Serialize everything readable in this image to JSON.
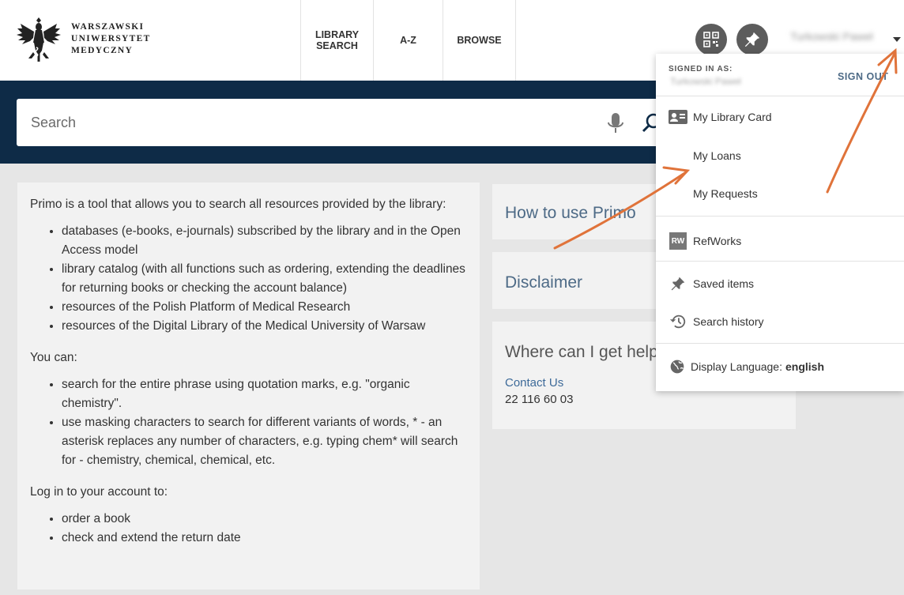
{
  "header": {
    "logo_lines": [
      "WARSZAWSKI",
      "UNIWERSYTET",
      "MEDYCZNY"
    ],
    "nav": [
      {
        "label": "LIBRARY\nSEARCH"
      },
      {
        "label": "A-Z"
      },
      {
        "label": "BROWSE"
      }
    ],
    "user_name": "Turkowski Paweł",
    "icons": {
      "qr": "qr-code-icon",
      "pin": "pin-icon",
      "caret": "chevron-down-icon"
    }
  },
  "search": {
    "placeholder": "Search",
    "icons": {
      "mic": "microphone-icon",
      "search": "search-icon"
    }
  },
  "main": {
    "intro": "Primo is a tool that allows you to search all resources provided by the library:",
    "resources": [
      "databases (e-books, e-journals) subscribed by the library and in the Open Access model",
      "library catalog (with all functions such as ordering, extending the deadlines for returning books or checking the account balance)",
      "resources of the Polish Platform of Medical Research",
      "resources of the Digital Library of the Medical University of Warsaw"
    ],
    "you_can": "You can:",
    "tips": [
      "search for the entire phrase using quotation marks, e.g. \"organic chemistry\".",
      "use masking characters to search for different variants of words, * - an asterisk replaces any number of characters, e.g. typing chem* will search for - chemistry, chemical, chemical, etc."
    ],
    "login_intro": "Log in to your account to:",
    "login_items": [
      "order a book",
      "check and extend the return date"
    ]
  },
  "side": {
    "how_to": "How to use Primo",
    "disclaimer": "Disclaimer",
    "help": "Where can I get help?",
    "contact": "Contact Us",
    "phone": "22 116 60 03"
  },
  "dropdown": {
    "signed_in_as": "SIGNED IN AS:",
    "user_name": "Turkowski Paweł",
    "sign_out": "SIGN OUT",
    "items": {
      "library_card": "My Library Card",
      "loans": "My Loans",
      "requests": "My Requests",
      "refworks": "RefWorks",
      "refworks_badge": "RW",
      "saved": "Saved items",
      "history": "Search history",
      "language_label": "Display Language:",
      "language_value": "english"
    }
  },
  "colors": {
    "search_band": "#0e2b47",
    "link": "#4d6a86",
    "arrow": "#e0733a"
  }
}
